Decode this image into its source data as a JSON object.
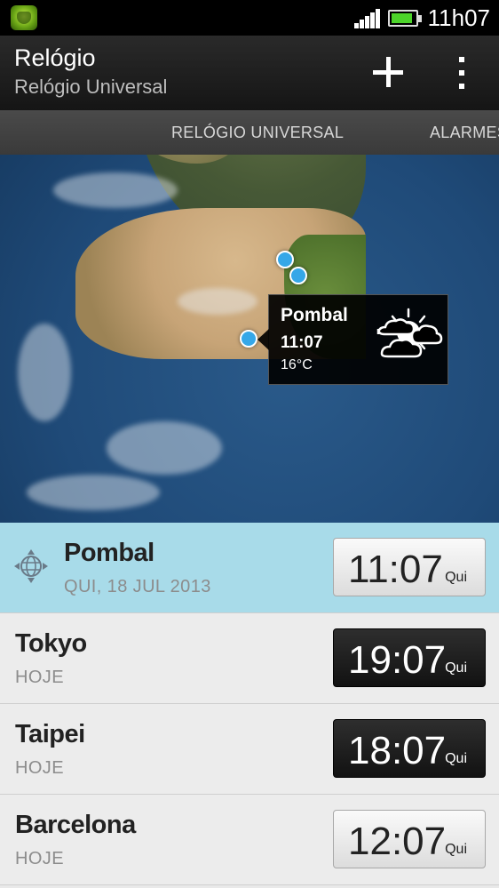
{
  "status_bar": {
    "time": "11h07",
    "battery_level": 0.9,
    "icons": [
      "app-notification-icon",
      "signal-icon",
      "battery-icon"
    ]
  },
  "action_bar": {
    "title": "Relógio",
    "subtitle": "Relógio Universal",
    "actions": [
      "add-icon",
      "overflow-menu-icon"
    ]
  },
  "tabs": [
    {
      "label": "RELÓGIO UNIVERSAL",
      "selected": true
    },
    {
      "label": "ALARMES",
      "selected": false
    }
  ],
  "map_popup": {
    "city": "Pombal",
    "time": "11:07",
    "temperature": "16°C",
    "weather_icon": "partly-cloudy-icon"
  },
  "cities": [
    {
      "name": "Pombal",
      "subtitle": "QUI, 18 JUL 2013",
      "time": "11:07",
      "day": "Qui",
      "current": true,
      "clock_style": "light"
    },
    {
      "name": "Tokyo",
      "subtitle": "HOJE",
      "time": "19:07",
      "day": "Qui",
      "current": false,
      "clock_style": "dark"
    },
    {
      "name": "Taipei",
      "subtitle": "HOJE",
      "time": "18:07",
      "day": "Qui",
      "current": false,
      "clock_style": "dark"
    },
    {
      "name": "Barcelona",
      "subtitle": "HOJE",
      "time": "12:07",
      "day": "Qui",
      "current": false,
      "clock_style": "light"
    }
  ],
  "colors": {
    "current_row": "#a8dbe9",
    "pin": "#35a7e8",
    "battery": "#4cd42a"
  }
}
